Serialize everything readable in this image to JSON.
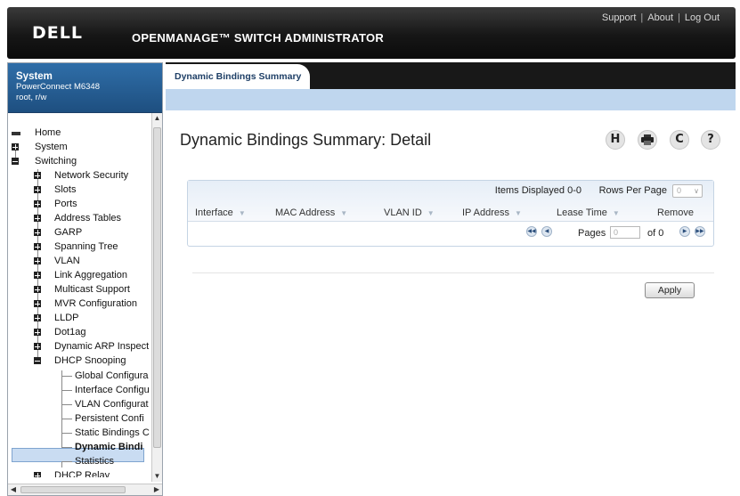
{
  "header": {
    "logo": "DELL",
    "app_title": "OPENMANAGE™ SWITCH ADMINISTRATOR",
    "links": [
      "Support",
      "About",
      "Log Out"
    ],
    "separator": "|"
  },
  "sidebar": {
    "system_title": "System",
    "device": "PowerConnect M6348",
    "user": "root, r/w",
    "tree": {
      "home": "Home",
      "system": "System",
      "switching": "Switching",
      "switching_children": [
        "Network Security",
        "Slots",
        "Ports",
        "Address Tables",
        "GARP",
        "Spanning Tree",
        "VLAN",
        "Link Aggregation",
        "Multicast Support",
        "MVR Configuration",
        "LLDP",
        "Dot1ag",
        "Dynamic ARP Inspect",
        "DHCP Snooping"
      ],
      "dhcp_children": [
        "Global Configura",
        "Interface Configu",
        "VLAN Configurat",
        "Persistent Confi",
        "Static Bindings C",
        "Dynamic Bindi",
        "Statistics"
      ],
      "dhcp_relay_partial": "DHCP Relay",
      "selected": "Dynamic Bindi"
    }
  },
  "main": {
    "tab_label": "Dynamic Bindings Summary",
    "page_title": "Dynamic Bindings Summary: Detail",
    "toolbar_icons": [
      "H",
      "printer",
      "C",
      "?"
    ],
    "grid": {
      "items_displayed": "Items Displayed 0-0",
      "rows_per_page_label": "Rows Per Page",
      "rows_per_page_value": "0",
      "columns": [
        "Interface",
        "MAC Address",
        "VLAN ID",
        "IP Address",
        "Lease Time",
        "Remove"
      ],
      "pages_label": "Pages",
      "pages_value": "0",
      "of_label": "of 0"
    },
    "apply_label": "Apply"
  }
}
